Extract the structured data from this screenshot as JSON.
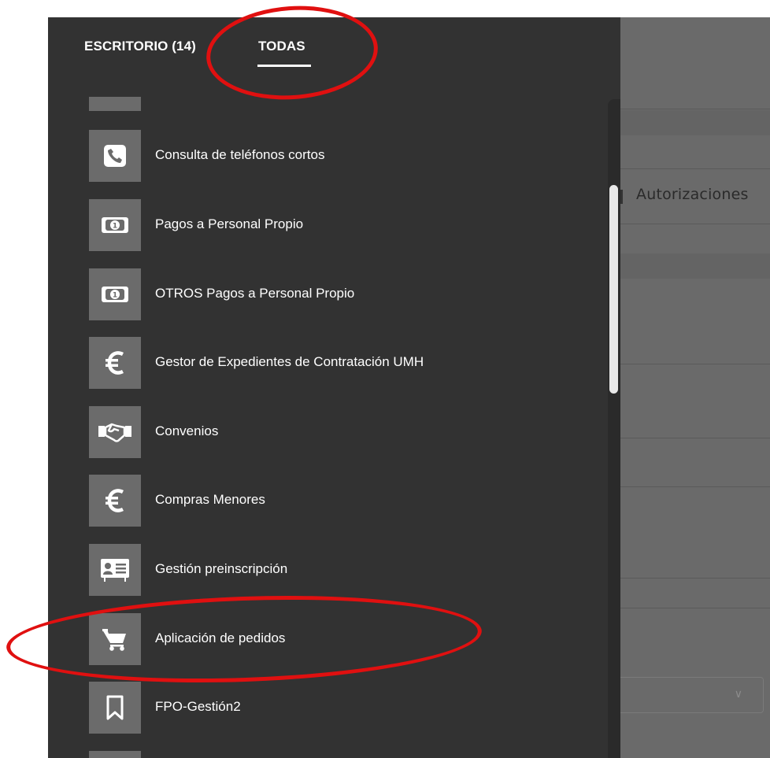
{
  "tabs": {
    "escritorio": "ESCRITORIO (14)",
    "todas": "TODAS"
  },
  "apps": [
    {
      "label": "Consulta de teléfonos cortos",
      "icon": "phone-icon"
    },
    {
      "label": "Pagos a Personal Propio",
      "icon": "banknote-icon"
    },
    {
      "label": "OTROS Pagos a Personal Propio",
      "icon": "banknote-icon"
    },
    {
      "label": "Gestor de Expedientes de Contratación UMH",
      "icon": "euro-icon"
    },
    {
      "label": "Convenios",
      "icon": "handshake-icon"
    },
    {
      "label": "Compras Menores",
      "icon": "euro-icon"
    },
    {
      "label": "Gestión preinscripción",
      "icon": "id-card-icon"
    },
    {
      "label": "Aplicación de pedidos",
      "icon": "shopping-cart-icon"
    },
    {
      "label": "FPO-Gestión2",
      "icon": "bookmark-icon"
    }
  ],
  "background_page": {
    "label": "Autorizaciones"
  },
  "colors": {
    "drawer": "#323232",
    "icon_tile": "#6b6b6b",
    "annotation": "#e01010",
    "dimmed_page": "#6a6a6a"
  }
}
